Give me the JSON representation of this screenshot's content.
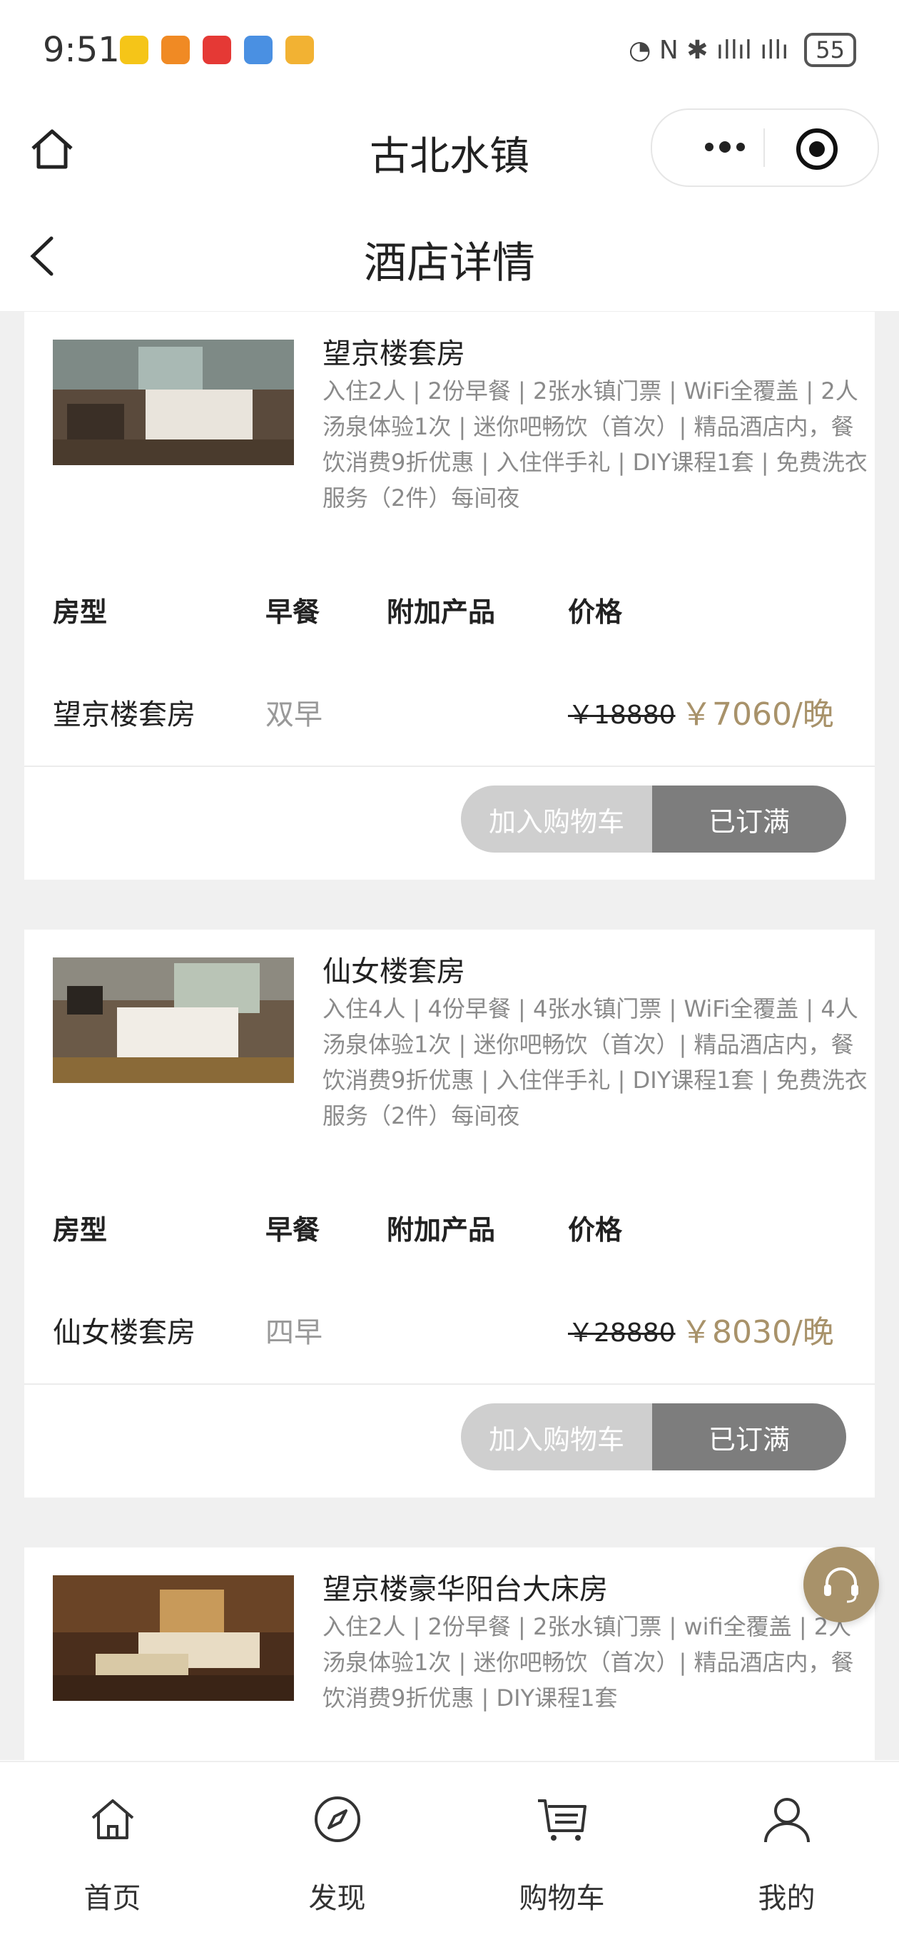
{
  "status_bar": {
    "time": "9:51",
    "battery": "55",
    "app_icon_colors": [
      "#f5c518",
      "#f08a24",
      "#e53935",
      "#4a90e2",
      "#f2b233"
    ]
  },
  "nav": {
    "app_title": "古北水镇",
    "more_icon": "more-dots-icon",
    "target_icon": "target-icon",
    "home_icon": "home-icon"
  },
  "page": {
    "title": "酒店详情",
    "back_icon": "back-chevron-icon"
  },
  "table_headers": {
    "room_type": "房型",
    "breakfast": "早餐",
    "addon": "附加产品",
    "price": "价格"
  },
  "rooms": [
    {
      "name": "望京楼套房",
      "desc": "入住2人 | 2份早餐 | 2张水镇门票 | WiFi全覆盖 | 2人汤泉体验1次 | 迷你吧畅饮（首次）| 精品酒店内，餐饮消费9折优惠 | 入住伴手礼 | DIY课程1套 | 免费洗衣服务（2件）每间夜",
      "room_type": "望京楼套房",
      "breakfast": "双早",
      "addon": "",
      "old_price": "￥18880",
      "new_price": "￥7060/晚",
      "add_to_cart": "加入购物车",
      "status": "已订满"
    },
    {
      "name": "仙女楼套房",
      "desc": "入住4人 | 4份早餐 | 4张水镇门票 | WiFi全覆盖 | 4人汤泉体验1次 | 迷你吧畅饮（首次）| 精品酒店内，餐饮消费9折优惠 | 入住伴手礼 | DIY课程1套 | 免费洗衣服务（2件）每间夜",
      "room_type": "仙女楼套房",
      "breakfast": "四早",
      "addon": "",
      "old_price": "￥28880",
      "new_price": "￥8030/晚",
      "add_to_cart": "加入购物车",
      "status": "已订满"
    },
    {
      "name": "望京楼豪华阳台大床房",
      "desc": "入住2人 | 2份早餐 | 2张水镇门票 | wifi全覆盖 | 2人汤泉体验1次 | 迷你吧畅饮（首次）| 精品酒店内，餐饮消费9折优惠 | DIY课程1套"
    }
  ],
  "tabbar": {
    "items": [
      {
        "label": "首页",
        "icon": "home-icon"
      },
      {
        "label": "发现",
        "icon": "compass-icon"
      },
      {
        "label": "购物车",
        "icon": "cart-icon"
      },
      {
        "label": "我的",
        "icon": "user-icon"
      }
    ]
  },
  "colors": {
    "accent": "#a8926a",
    "booked_button": "#7d7d7d",
    "cart_button": "#cfcfcf",
    "background": "#f0f0f0"
  }
}
